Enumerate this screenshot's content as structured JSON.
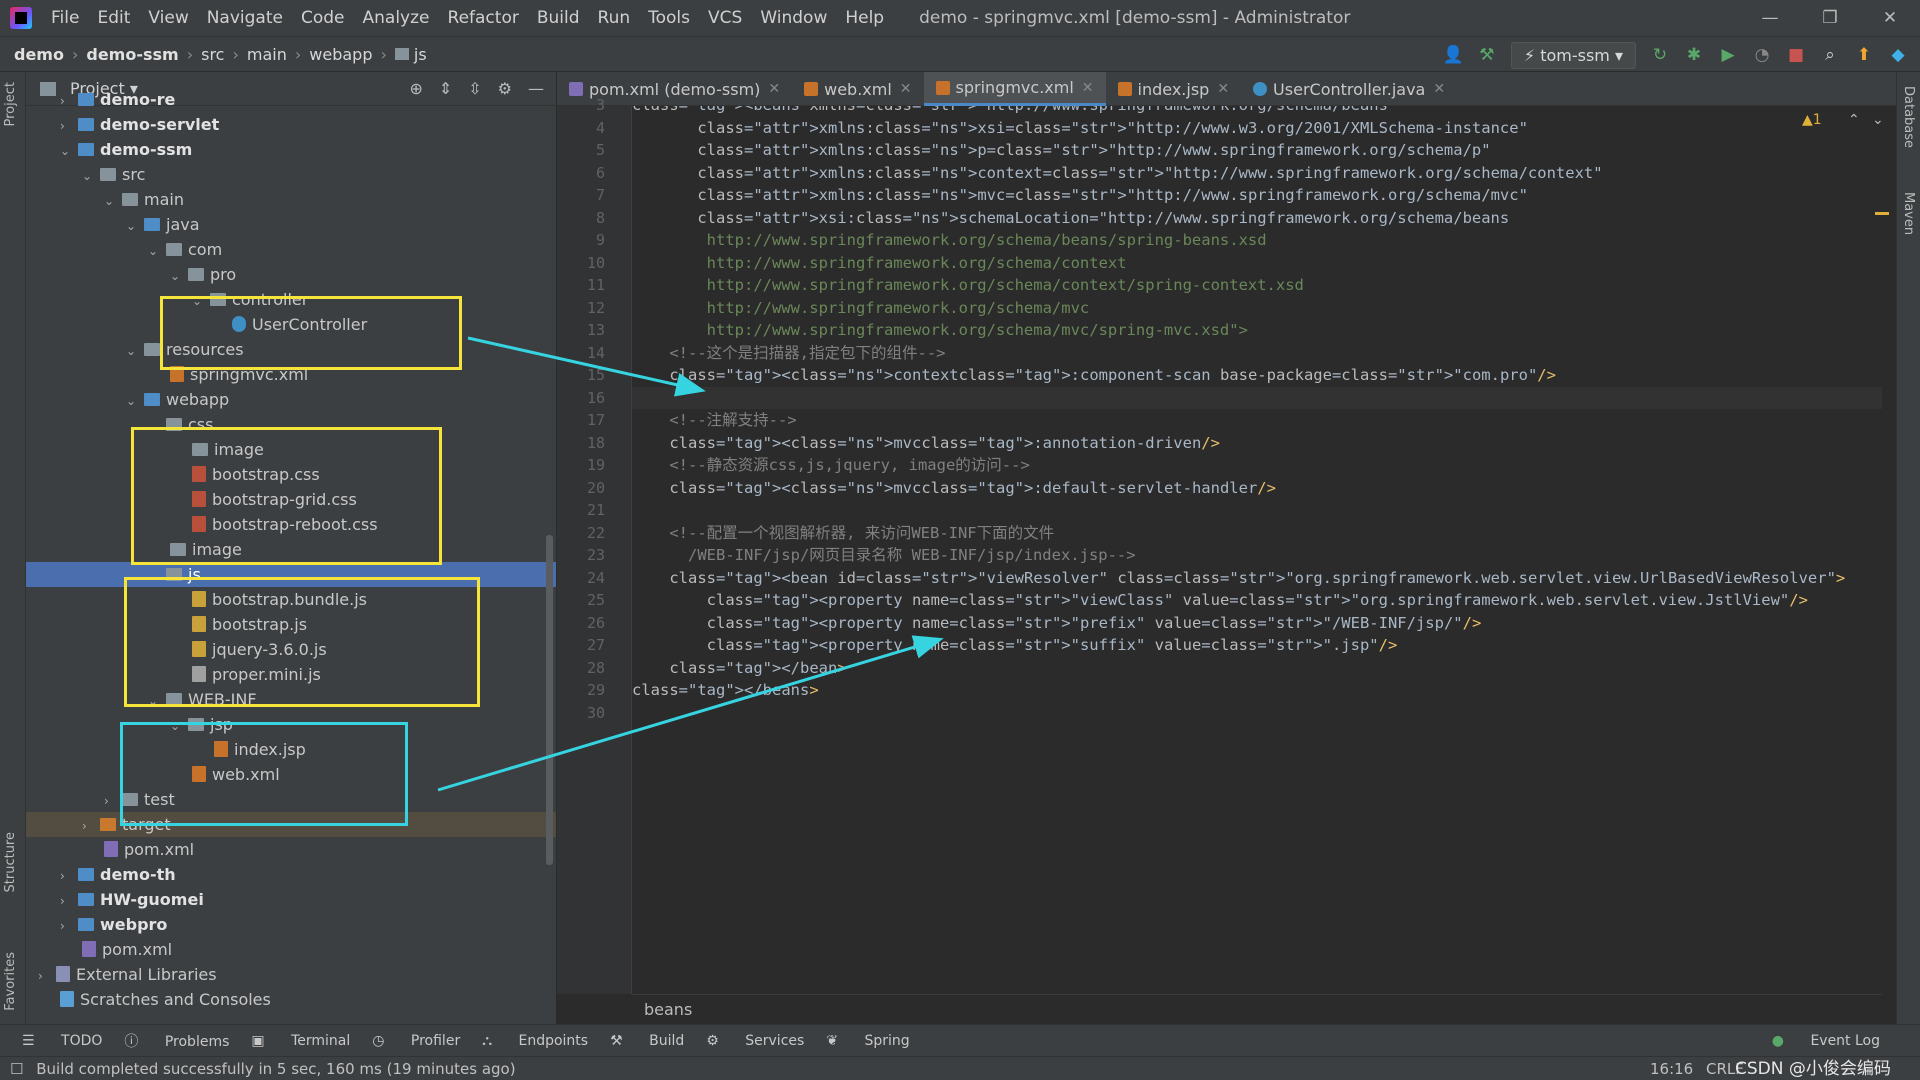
{
  "title_bar": {
    "menu": [
      "File",
      "Edit",
      "View",
      "Navigate",
      "Code",
      "Analyze",
      "Refactor",
      "Build",
      "Run",
      "Tools",
      "VCS",
      "Window",
      "Help"
    ],
    "window_title": "demo - springmvc.xml [demo-ssm] - Administrator",
    "controls": [
      "—",
      "❐",
      "✕"
    ]
  },
  "breadcrumb": [
    "demo",
    "demo-ssm",
    "src",
    "main",
    "webapp",
    "js"
  ],
  "run_config": "tom-ssm",
  "project_panel": {
    "title": "Project",
    "tree": [
      {
        "label": "demo-re",
        "bold": true
      },
      {
        "label": "demo-servlet",
        "bold": true
      },
      {
        "label": "demo-ssm",
        "bold": true
      },
      {
        "label": "src"
      },
      {
        "label": "main"
      },
      {
        "label": "java"
      },
      {
        "label": "com"
      },
      {
        "label": "pro"
      },
      {
        "label": "controller"
      },
      {
        "label": "UserController"
      },
      {
        "label": "resources"
      },
      {
        "label": "springmvc.xml"
      },
      {
        "label": "webapp"
      },
      {
        "label": "css"
      },
      {
        "label": "image"
      },
      {
        "label": "bootstrap.css"
      },
      {
        "label": "bootstrap-grid.css"
      },
      {
        "label": "bootstrap-reboot.css"
      },
      {
        "label": "image"
      },
      {
        "label": "js"
      },
      {
        "label": "bootstrap.bundle.js"
      },
      {
        "label": "bootstrap.js"
      },
      {
        "label": "jquery-3.6.0.js"
      },
      {
        "label": "proper.mini.js"
      },
      {
        "label": "WEB-INF"
      },
      {
        "label": "jsp"
      },
      {
        "label": "index.jsp"
      },
      {
        "label": "web.xml"
      },
      {
        "label": "test"
      },
      {
        "label": "target"
      },
      {
        "label": "pom.xml"
      },
      {
        "label": "demo-th",
        "bold": true
      },
      {
        "label": "HW-guomei",
        "bold": true
      },
      {
        "label": "webpro",
        "bold": true
      },
      {
        "label": "pom.xml"
      },
      {
        "label": "External Libraries"
      },
      {
        "label": "Scratches and Consoles"
      }
    ]
  },
  "editor_tabs": [
    {
      "label": "pom.xml (demo-ssm)",
      "color": "#7f6db5"
    },
    {
      "label": "web.xml",
      "color": "#c7722a"
    },
    {
      "label": "springmvc.xml",
      "color": "#c7722a",
      "active": true
    },
    {
      "label": "index.jsp",
      "color": "#c7722a"
    },
    {
      "label": "UserController.java",
      "color": "#3d8fc4"
    }
  ],
  "editor": {
    "warnings": "▲1",
    "lines": [
      {
        "n": "3",
        "t": "<beans xmlns=\"http://www.springframework.org/schema/beans\""
      },
      {
        "n": "4",
        "t": "       xmlns:xsi=\"http://www.w3.org/2001/XMLSchema-instance\""
      },
      {
        "n": "5",
        "t": "       xmlns:p=\"http://www.springframework.org/schema/p\""
      },
      {
        "n": "6",
        "t": "       xmlns:context=\"http://www.springframework.org/schema/context\""
      },
      {
        "n": "7",
        "t": "       xmlns:mvc=\"http://www.springframework.org/schema/mvc\""
      },
      {
        "n": "8",
        "t": "       xsi:schemaLocation=\"http://www.springframework.org/schema/beans"
      },
      {
        "n": "9",
        "t": "        http://www.springframework.org/schema/beans/spring-beans.xsd"
      },
      {
        "n": "10",
        "t": "        http://www.springframework.org/schema/context"
      },
      {
        "n": "11",
        "t": "        http://www.springframework.org/schema/context/spring-context.xsd"
      },
      {
        "n": "12",
        "t": "        http://www.springframework.org/schema/mvc"
      },
      {
        "n": "13",
        "t": "        http://www.springframework.org/schema/mvc/spring-mvc.xsd\">"
      },
      {
        "n": "14",
        "t": "    <!--这个是扫描器,指定包下的组件-->"
      },
      {
        "n": "15",
        "t": "    <context:component-scan base-package=\"com.pro\"/>"
      },
      {
        "n": "16",
        "t": ""
      },
      {
        "n": "17",
        "t": "    <!--注解支持-->"
      },
      {
        "n": "18",
        "t": "    <mvc:annotation-driven/>"
      },
      {
        "n": "19",
        "t": "    <!--静态资源css,js,jquery, image的访问-->"
      },
      {
        "n": "20",
        "t": "    <mvc:default-servlet-handler/>"
      },
      {
        "n": "21",
        "t": ""
      },
      {
        "n": "22",
        "t": "    <!--配置一个视图解析器, 来访问WEB-INF下面的文件"
      },
      {
        "n": "23",
        "t": "      /WEB-INF/jsp/网页目录名称 WEB-INF/jsp/index.jsp-->"
      },
      {
        "n": "24",
        "t": "    <bean id=\"viewResolver\" class=\"org.springframework.web.servlet.view.UrlBasedViewResolver\">"
      },
      {
        "n": "25",
        "t": "        <property name=\"viewClass\" value=\"org.springframework.web.servlet.view.JstlView\"/>"
      },
      {
        "n": "26",
        "t": "        <property name=\"prefix\" value=\"/WEB-INF/jsp/\"/>"
      },
      {
        "n": "27",
        "t": "        <property name=\"suffix\" value=\".jsp\"/>"
      },
      {
        "n": "28",
        "t": "    </bean>"
      },
      {
        "n": "29",
        "t": "</beans>"
      },
      {
        "n": "30",
        "t": ""
      }
    ],
    "breadcrumb": "beans"
  },
  "tool_windows": [
    "TODO",
    "Problems",
    "Terminal",
    "Profiler",
    "Endpoints",
    "Build",
    "Services",
    "Spring"
  ],
  "event_log": "Event Log",
  "status": {
    "message": "Build completed successfully in 5 sec, 160 ms (19 minutes ago)",
    "position": "16:16",
    "line_sep": "CRLF",
    "watermark": "CSDN @小俊会编码"
  },
  "side_labels": {
    "project": "Project",
    "structure": "Structure",
    "favorites": "Favorites",
    "database": "Database",
    "maven": "Maven"
  },
  "colors": {
    "highlight_box": "#f5e43a",
    "cyan_box": "#36d4e0",
    "selection": "#4b6eaf"
  }
}
